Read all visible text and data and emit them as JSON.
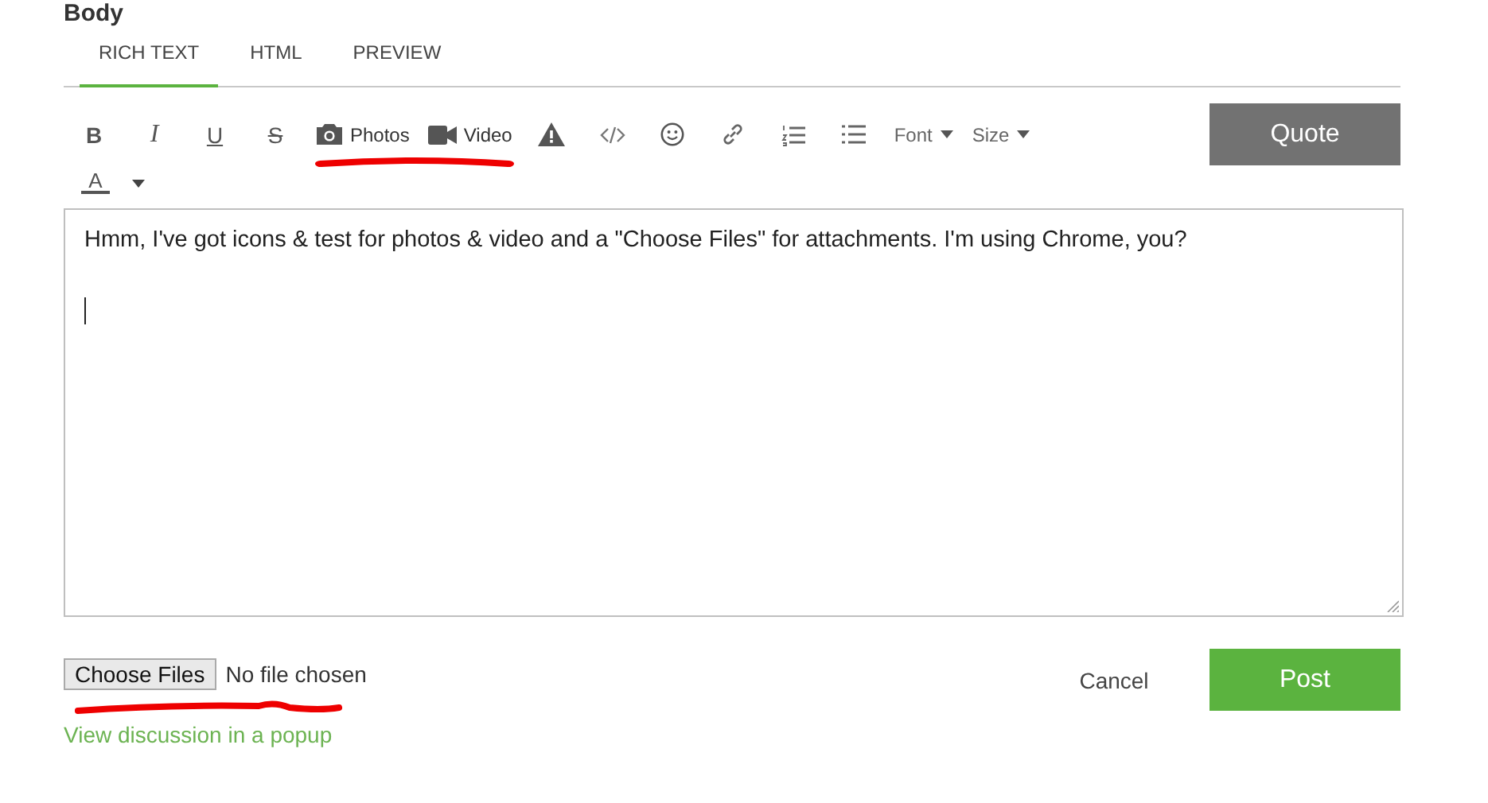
{
  "section_title": "Body",
  "tabs": [
    {
      "label": "RICH TEXT",
      "selected": true
    },
    {
      "label": "HTML",
      "selected": false
    },
    {
      "label": "PREVIEW",
      "selected": false
    }
  ],
  "toolbar": [
    {
      "kind": "bold",
      "glyph": "B"
    },
    {
      "kind": "italic",
      "glyph": "I"
    },
    {
      "kind": "underline",
      "glyph": "U"
    },
    {
      "kind": "strike",
      "glyph": "S"
    },
    {
      "kind": "photos",
      "label": "Photos",
      "annotated": true
    },
    {
      "kind": "video",
      "label": "Video"
    },
    {
      "kind": "warning"
    },
    {
      "kind": "code"
    },
    {
      "kind": "emoji"
    },
    {
      "kind": "link"
    },
    {
      "kind": "ordered-list"
    },
    {
      "kind": "bullet-list"
    },
    {
      "kind": "dropdown",
      "label": "Font"
    },
    {
      "kind": "dropdown",
      "label": "Size"
    }
  ],
  "quote_button": "Quote",
  "font_color": {
    "glyph": "A"
  },
  "editor": {
    "text": "Hmm, I've got icons & test for photos & video and a \"Choose Files\" for attachments.  I'm using Chrome, you?"
  },
  "file_input": {
    "button": "Choose Files",
    "status": "No file chosen",
    "annotated": true
  },
  "cancel_button": "Cancel",
  "post_button": "Post",
  "popup_link": "View discussion in a popup"
}
